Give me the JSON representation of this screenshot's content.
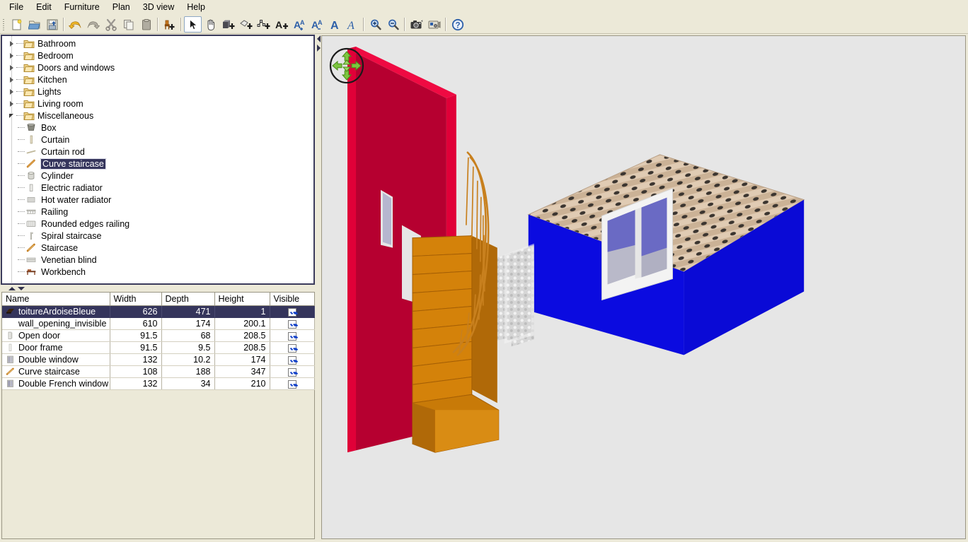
{
  "window": {
    "title": "Sweet Home 3D"
  },
  "menubar": {
    "items": [
      {
        "label": "File",
        "name": "menu-file"
      },
      {
        "label": "Edit",
        "name": "menu-edit"
      },
      {
        "label": "Furniture",
        "name": "menu-furniture"
      },
      {
        "label": "Plan",
        "name": "menu-plan"
      },
      {
        "label": "3D view",
        "name": "menu-3d-view"
      },
      {
        "label": "Help",
        "name": "menu-help"
      }
    ]
  },
  "toolbar": {
    "buttons": [
      {
        "icon": "new-document-icon",
        "label": "New home"
      },
      {
        "icon": "open-folder-icon",
        "label": "Open"
      },
      {
        "icon": "save-disk-icon",
        "label": "Save"
      },
      {
        "icon": "undo-arrow-icon",
        "label": "Undo"
      },
      {
        "icon": "redo-arrow-icon",
        "label": "Redo"
      },
      {
        "icon": "scissors-cut-icon",
        "label": "Cut"
      },
      {
        "icon": "copy-pages-icon",
        "label": "Copy"
      },
      {
        "icon": "paste-clipboard-icon",
        "label": "Paste"
      },
      {
        "icon": "add-furniture-icon",
        "label": "Add furniture"
      },
      {
        "icon": "select-arrow-icon",
        "label": "Select",
        "selected": true
      },
      {
        "icon": "pan-hand-icon",
        "label": "Pan"
      },
      {
        "icon": "create-walls-icon",
        "label": "Create walls"
      },
      {
        "icon": "create-rooms-icon",
        "label": "Create rooms"
      },
      {
        "icon": "create-polyline-icon",
        "label": "Create polylines"
      },
      {
        "icon": "add-text-icon",
        "label": "Add texts"
      },
      {
        "icon": "increase-text-size-icon",
        "label": "Increase text size"
      },
      {
        "icon": "decrease-text-size-icon",
        "label": "Decrease text size"
      },
      {
        "icon": "bold-text-icon",
        "label": "Toggle bold style"
      },
      {
        "icon": "italic-text-icon",
        "label": "Toggle italic style"
      },
      {
        "icon": "zoom-in-icon",
        "label": "Zoom in"
      },
      {
        "icon": "zoom-out-icon",
        "label": "Zoom out"
      },
      {
        "icon": "photo-camera-icon",
        "label": "Create photo"
      },
      {
        "icon": "video-camera-icon",
        "label": "Create video"
      },
      {
        "icon": "help-question-icon",
        "label": "Help"
      }
    ]
  },
  "catalog": {
    "categories": [
      {
        "label": "Bathroom",
        "expanded": false
      },
      {
        "label": "Bedroom",
        "expanded": false
      },
      {
        "label": "Doors and windows",
        "expanded": false
      },
      {
        "label": "Kitchen",
        "expanded": false
      },
      {
        "label": "Lights",
        "expanded": false
      },
      {
        "label": "Living room",
        "expanded": false
      },
      {
        "label": "Miscellaneous",
        "expanded": true
      }
    ],
    "miscellaneous_items": [
      {
        "label": "Box",
        "icon": "box-icon",
        "selected": false
      },
      {
        "label": "Curtain",
        "icon": "curtain-icon",
        "selected": false
      },
      {
        "label": "Curtain rod",
        "icon": "curtain-rod-icon",
        "selected": false
      },
      {
        "label": "Curve staircase",
        "icon": "curve-staircase-icon",
        "selected": true
      },
      {
        "label": "Cylinder",
        "icon": "cylinder-icon",
        "selected": false
      },
      {
        "label": "Electric radiator",
        "icon": "electric-radiator-icon",
        "selected": false
      },
      {
        "label": "Hot water radiator",
        "icon": "hot-water-radiator-icon",
        "selected": false
      },
      {
        "label": "Railing",
        "icon": "railing-icon",
        "selected": false
      },
      {
        "label": "Rounded edges railing",
        "icon": "rounded-edges-railing-icon",
        "selected": false
      },
      {
        "label": "Spiral staircase",
        "icon": "spiral-staircase-icon",
        "selected": false
      },
      {
        "label": "Staircase",
        "icon": "staircase-icon",
        "selected": false
      },
      {
        "label": "Venetian blind",
        "icon": "venetian-blind-icon",
        "selected": false
      },
      {
        "label": "Workbench",
        "icon": "workbench-icon",
        "selected": false
      }
    ]
  },
  "furniture_table": {
    "columns": [
      "Name",
      "Width",
      "Depth",
      "Height",
      "Visible"
    ],
    "rows": [
      {
        "name": "toitureArdoiseBleue",
        "width": "626",
        "depth": "471",
        "height": "1",
        "visible": true,
        "selected": true,
        "icon": "roof-icon"
      },
      {
        "name": "wall_opening_invisible",
        "width": "610",
        "depth": "174",
        "height": "200.1",
        "visible": true,
        "selected": false,
        "icon": "none"
      },
      {
        "name": "Open door",
        "width": "91.5",
        "depth": "68",
        "height": "208.5",
        "visible": true,
        "selected": false,
        "icon": "door-icon"
      },
      {
        "name": "Door frame",
        "width": "91.5",
        "depth": "9.5",
        "height": "208.5",
        "visible": true,
        "selected": false,
        "icon": "door-frame-icon"
      },
      {
        "name": "Double window",
        "width": "132",
        "depth": "10.2",
        "height": "174",
        "visible": true,
        "selected": false,
        "icon": "window-icon"
      },
      {
        "name": "Curve staircase",
        "width": "108",
        "depth": "188",
        "height": "347",
        "visible": true,
        "selected": false,
        "icon": "curve-staircase-icon"
      },
      {
        "name": "Double French window",
        "width": "132",
        "depth": "34",
        "height": "210",
        "visible": true,
        "selected": false,
        "icon": "french-window-icon"
      }
    ]
  },
  "view3d": {
    "compass_icon": "navigation-compass-icon",
    "background_color": "#e6e6e6",
    "scene": {
      "description": "3D perspective of a house with a red wall, blue wall, tiled roof and orange curve staircase",
      "red_wall_color": "#AA0029",
      "blue_wall_color": "#0000DD",
      "roof_color": "#D2B294",
      "staircase_color": "#D4820A",
      "window_frame_color": "#F2F2F2",
      "glass_color": "#6B6BC8"
    }
  }
}
